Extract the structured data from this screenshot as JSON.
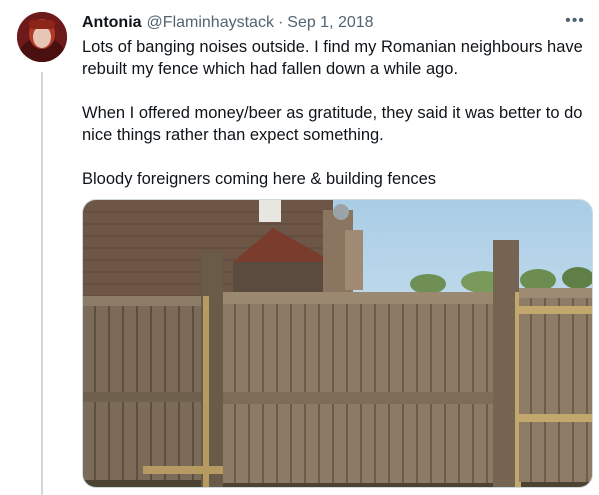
{
  "tweet": {
    "author": {
      "display_name": "Antonia",
      "handle": "@Flaminhaystack",
      "separator": "·",
      "date": "Sep 1, 2018",
      "avatar_icon": "profile-photo"
    },
    "more_label": "•••",
    "paragraphs": [
      "Lots of banging noises outside. I find my Romanian neighbours have rebuilt my fence which had fallen down a while ago.",
      "When I offered money/beer as gratitude, they said it was better to do nice things rather than expect something.",
      "Bloody foreigners coming here & building fences"
    ],
    "media": {
      "alt_icon": "photo-fence-garden"
    }
  },
  "colors": {
    "text": "#0f1419",
    "muted": "#536471",
    "thread_line": "#cfd9de"
  }
}
